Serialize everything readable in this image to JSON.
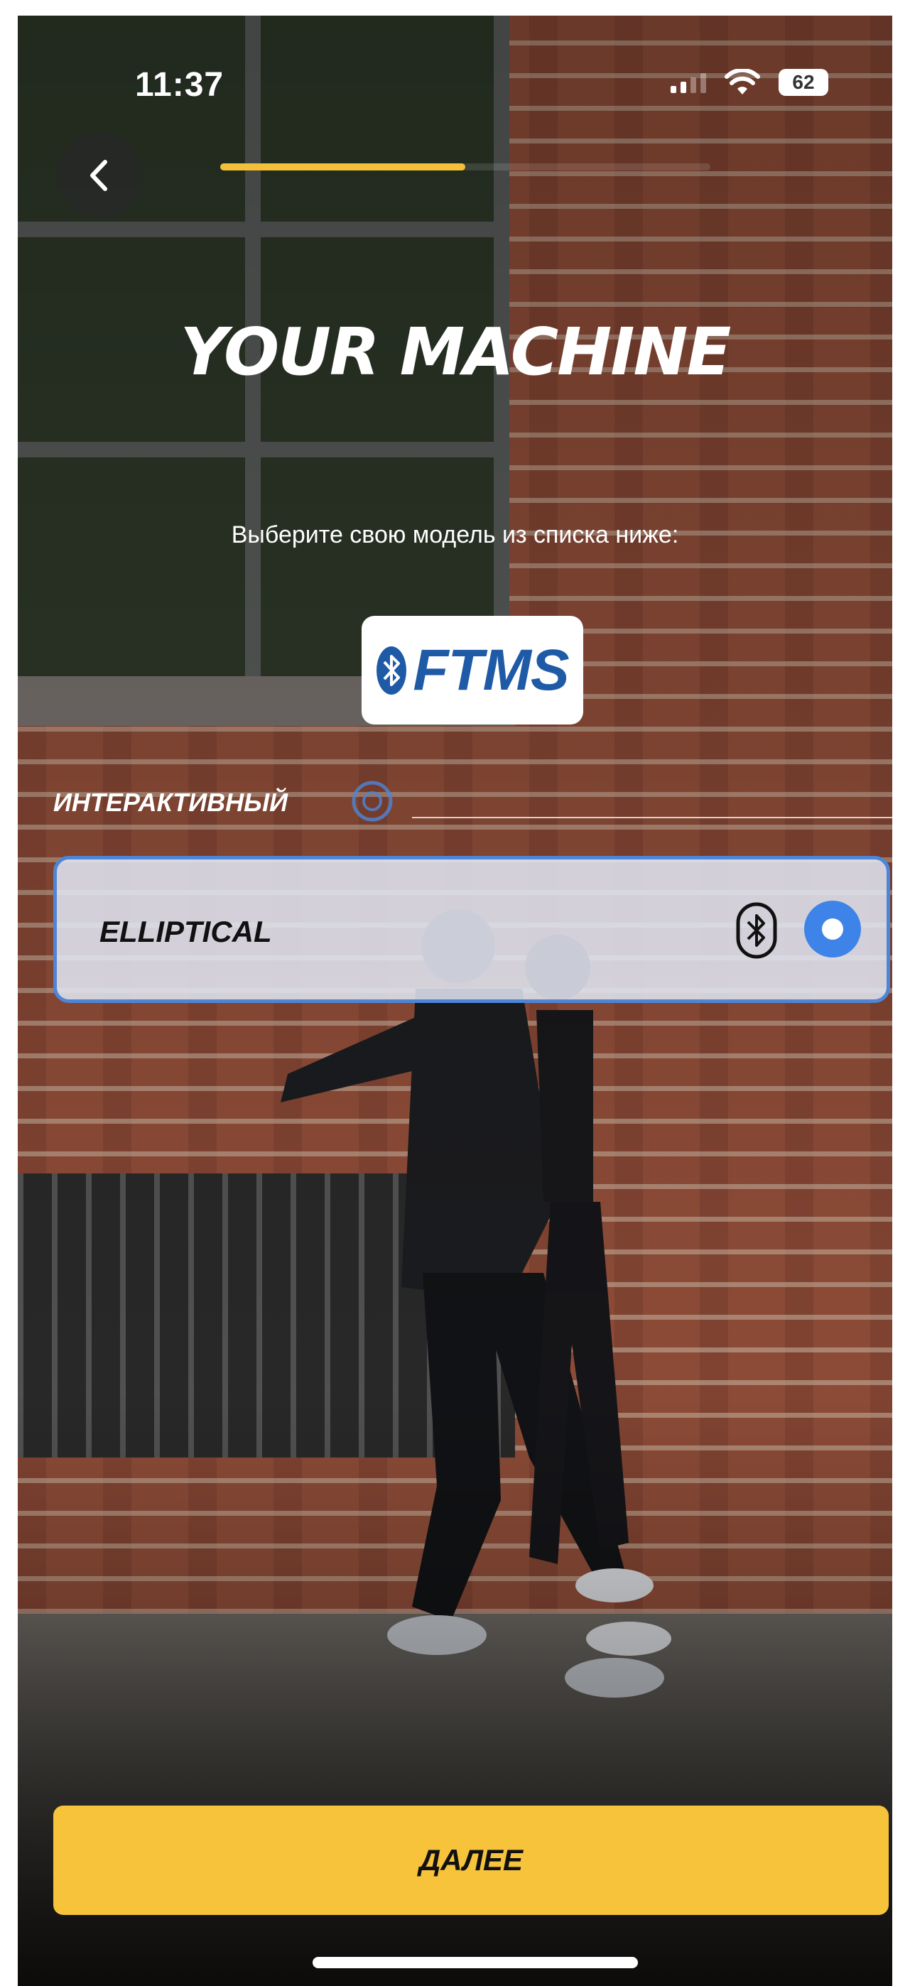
{
  "status_bar": {
    "time": "11:37",
    "battery": "62",
    "icons": [
      "cellular-signal-icon",
      "wifi-icon",
      "battery-icon"
    ]
  },
  "header": {
    "back_icon": "chevron-left-icon",
    "progress_fraction": 0.5,
    "title": "YOUR MACHINE",
    "subtitle": "Выберите свою модель из списка ниже:"
  },
  "brand": {
    "logo_text": "FTMS",
    "logo_icon": "bluetooth-icon",
    "logo_color": "#1f5aa6"
  },
  "section": {
    "label": "ИНТЕРАКТИВНЫЙ",
    "icon": "interactive-icon"
  },
  "options": [
    {
      "label": "ELLIPTICAL",
      "selected": true,
      "icon": "bluetooth-icon"
    }
  ],
  "actions": {
    "next_label": "ДАЛЕЕ"
  },
  "colors": {
    "accent": "#f7c33b",
    "selection": "#3e84e8",
    "card_border": "#4d86d8"
  }
}
